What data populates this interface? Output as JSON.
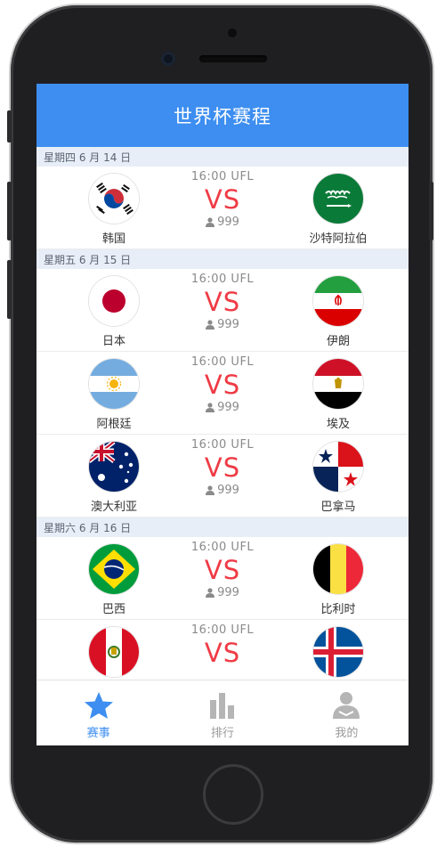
{
  "header": {
    "title": "世界杯赛程"
  },
  "days": [
    {
      "label": "星期四 6 月 14 日",
      "matches": [
        {
          "home": "韩国",
          "away": "沙特阿拉伯",
          "time": "16:00  UFL",
          "vs": "VS",
          "count": "999",
          "home_flag": "korea-flag-icon",
          "away_flag": "saudi-arabia-flag-icon"
        }
      ]
    },
    {
      "label": "星期五 6 月 15 日",
      "matches": [
        {
          "home": "日本",
          "away": "伊朗",
          "time": "16:00  UFL",
          "vs": "VS",
          "count": "999",
          "home_flag": "japan-flag-icon",
          "away_flag": "iran-flag-icon"
        },
        {
          "home": "阿根廷",
          "away": "埃及",
          "time": "16:00  UFL",
          "vs": "VS",
          "count": "999",
          "home_flag": "argentina-flag-icon",
          "away_flag": "egypt-flag-icon"
        },
        {
          "home": "澳大利亚",
          "away": "巴拿马",
          "time": "16:00  UFL",
          "vs": "VS",
          "count": "999",
          "home_flag": "australia-flag-icon",
          "away_flag": "panama-flag-icon"
        }
      ]
    },
    {
      "label": "星期六 6 月 16 日",
      "matches": [
        {
          "home": "巴西",
          "away": "比利时",
          "time": "16:00  UFL",
          "vs": "VS",
          "count": "999",
          "home_flag": "brazil-flag-icon",
          "away_flag": "belgium-flag-icon"
        },
        {
          "home": "",
          "away": "",
          "time": "16:00  UFL",
          "vs": "VS",
          "count": "",
          "home_flag": "peru-flag-icon",
          "away_flag": "iceland-flag-icon"
        }
      ]
    }
  ],
  "tabs": [
    {
      "label": "赛事",
      "icon": "star-icon",
      "active": true
    },
    {
      "label": "排行",
      "icon": "bar-chart-icon",
      "active": false
    },
    {
      "label": "我的",
      "icon": "user-icon",
      "active": false
    }
  ],
  "colors": {
    "accent": "#3d8ef0",
    "vs": "#ef3b45",
    "inactive": "#9a9a9a"
  }
}
